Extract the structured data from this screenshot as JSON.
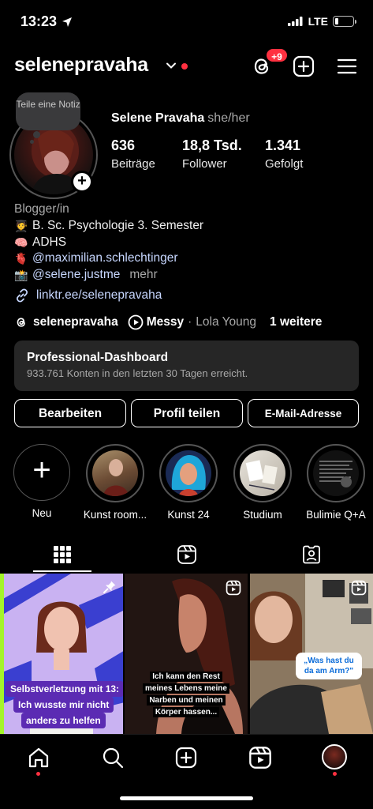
{
  "status": {
    "time": "13:23",
    "network": "LTE"
  },
  "header": {
    "username": "selenepravaha",
    "notif_count": "+9"
  },
  "note": {
    "text": "Teile eine Notiz"
  },
  "profile": {
    "full_name": "Selene Pravaha",
    "pronouns": "she/her",
    "stats": [
      {
        "value": "636",
        "label": "Beiträge"
      },
      {
        "value": "18,8 Tsd.",
        "label": "Follower"
      },
      {
        "value": "1.341",
        "label": "Gefolgt"
      }
    ]
  },
  "bio": {
    "category": "Blogger/in",
    "line1": "B. Sc. Psychologie 3. Semester",
    "line2": "ADHS",
    "mention1": "@maximilian.schlechtinger",
    "mention2": "@selene.justme",
    "more": "mehr",
    "link": "linktr.ee/selenepravaha"
  },
  "threads_row": {
    "handle": "selenepravaha",
    "song": "Messy",
    "separator": "·",
    "artist": "Lola Young",
    "more": "1 weitere"
  },
  "dashboard": {
    "title": "Professional-Dashboard",
    "subtitle": "933.761 Konten in den letzten 30 Tagen erreicht."
  },
  "actions": {
    "edit": "Bearbeiten",
    "share": "Profil teilen",
    "email": "E-Mail-Adresse"
  },
  "highlights": [
    {
      "label": "Neu"
    },
    {
      "label": "Kunst room..."
    },
    {
      "label": "Kunst 24"
    },
    {
      "label": "Studium"
    },
    {
      "label": "Bulimie Q+A"
    }
  ],
  "posts": {
    "post1_line1": "Selbstverletzung mit 13:",
    "post1_line2": "Ich wusste mir nicht",
    "post1_line3": "anders zu helfen",
    "post2_line1": "Ich kann den Rest",
    "post2_line2": "meines Lebens meine",
    "post2_line3": "Narben und meinen",
    "post2_line4": "Körper hassen...",
    "post3_text": "„Was hast du da am Arm?\""
  }
}
